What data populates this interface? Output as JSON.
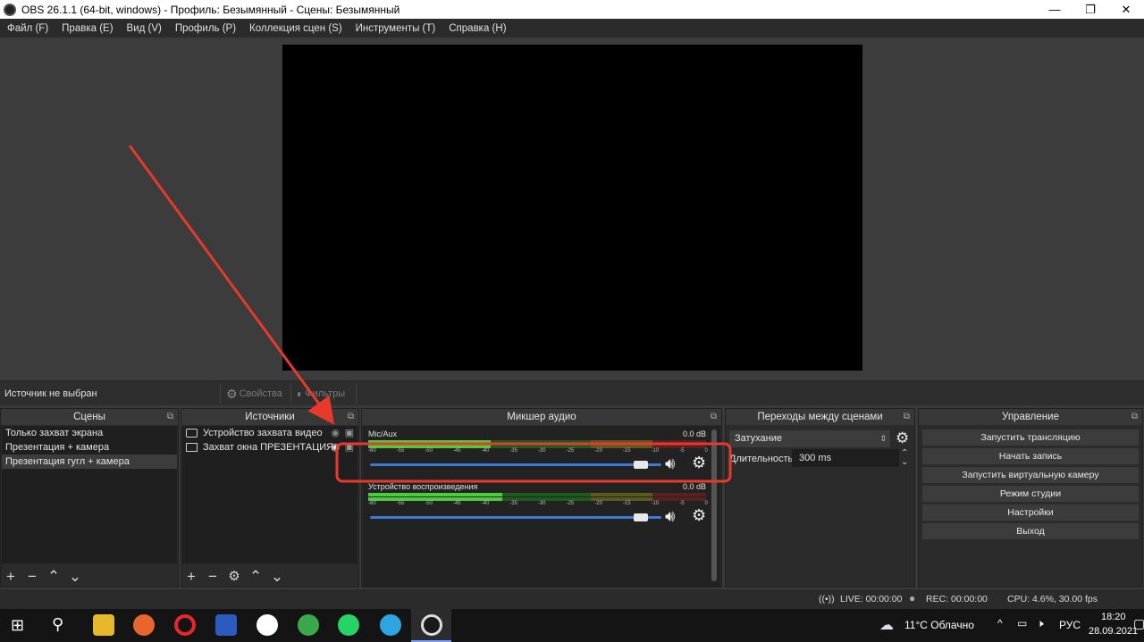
{
  "window": {
    "title": "OBS 26.1.1 (64-bit, windows) - Профиль: Безымянный - Сцены: Безымянный"
  },
  "menu": [
    "Файл (F)",
    "Правка (E)",
    "Вид (V)",
    "Профиль (P)",
    "Коллекция сцен (S)",
    "Инструменты (T)",
    "Справка (H)"
  ],
  "source_bar": {
    "status": "Источник не выбран",
    "properties": "Свойства",
    "filters": "Фильтры"
  },
  "scenes": {
    "title": "Сцены",
    "items": [
      "Только захват экрана",
      "Презентация + камера",
      "Презентация гугл + камера"
    ],
    "selected_index": 2
  },
  "sources": {
    "title": "Источники",
    "items": [
      "Устройство захвата видео",
      "Захват окна ПРЕЗЕНТАЦИЯ"
    ]
  },
  "mixer": {
    "title": "Микшер аудио",
    "ticks": [
      "-60",
      "-55",
      "-50",
      "-45",
      "-40",
      "-35",
      "-30",
      "-25",
      "-20",
      "-15",
      "-10",
      "-5",
      "0"
    ],
    "channels": [
      {
        "name": "Mic/Aux",
        "db": "0.0 dB",
        "volume": 0.93
      },
      {
        "name": "Устройство воспроизведения",
        "db": "0.0 dB",
        "volume": 0.93
      }
    ]
  },
  "transitions": {
    "title": "Переходы между сценами",
    "selected": "Затухание",
    "duration_label": "Длительность",
    "duration_value": "300 ms"
  },
  "controls": {
    "title": "Управление",
    "buttons": [
      "Запустить трансляцию",
      "Начать запись",
      "Запустить виртуальную камеру",
      "Режим студии",
      "Настройки",
      "Выход"
    ]
  },
  "status": {
    "live": "LIVE: 00:00:00",
    "rec": "REC: 00:00:00",
    "cpu": "CPU: 4.6%, 30.00 fps"
  },
  "taskbar": {
    "weather": "11°C  Облачно",
    "lang": "РУС",
    "time": "18:20",
    "date": "28.09.2021"
  },
  "colors": {
    "accent": "#3b7bd6",
    "annotation": "#e8392c",
    "meter_green": "#4ccc3c"
  }
}
